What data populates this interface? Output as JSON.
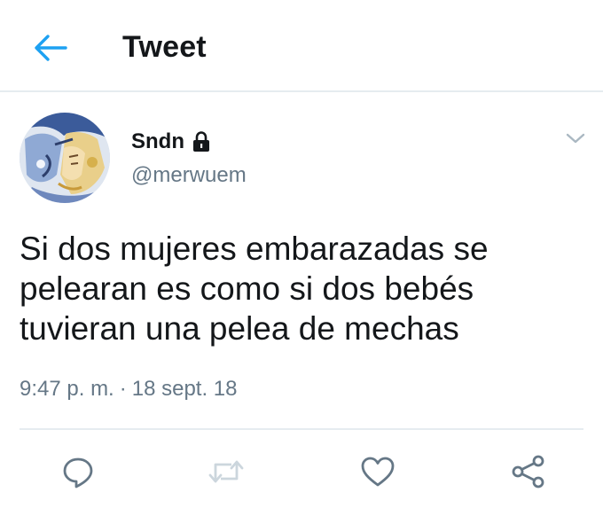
{
  "header": {
    "title": "Tweet",
    "back_icon": "back-arrow-icon",
    "accent_color": "#1da1f2"
  },
  "tweet": {
    "author": {
      "display_name": "Sndn",
      "handle": "@merwuem",
      "protected": true,
      "avatar": "anime-character-avatar"
    },
    "text_lines": [
      "Si dos mujeres embarazadas se",
      "pelearan es como si dos bebés",
      "tuvieran una pelea de mechas"
    ],
    "time": "9:47 p. m.",
    "separator": "·",
    "date": "18 sept. 18"
  },
  "actions": [
    {
      "icon": "reply-icon"
    },
    {
      "icon": "retweet-icon"
    },
    {
      "icon": "like-icon"
    },
    {
      "icon": "share-icon"
    }
  ],
  "colors": {
    "text": "#14171a",
    "secondary": "#657786",
    "icon": "#657786",
    "retweet_disabled": "#ccd6dd",
    "border": "#e6ecf0"
  }
}
